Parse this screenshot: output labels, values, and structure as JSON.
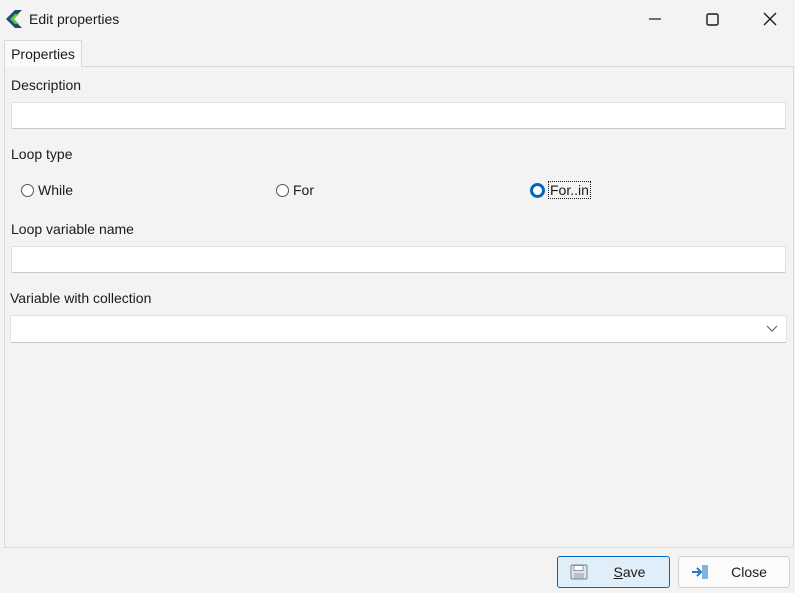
{
  "window": {
    "title": "Edit properties",
    "app_icon": "app-logo-icon",
    "controls": [
      "minimize-icon",
      "maximize-icon",
      "close-icon"
    ]
  },
  "tabs": [
    {
      "label": "Properties",
      "active": true
    }
  ],
  "form": {
    "description": {
      "label": "Description",
      "value": "",
      "placeholder": ""
    },
    "loop_type": {
      "label": "Loop type",
      "options": [
        {
          "label": "While",
          "selected": false
        },
        {
          "label": "For",
          "selected": false
        },
        {
          "label": "For..in",
          "selected": false,
          "focused": true
        }
      ]
    },
    "loop_variable_name": {
      "label": "Loop variable name",
      "value": "",
      "placeholder": ""
    },
    "variable_with_collection": {
      "label": "Variable with collection",
      "selected_value": ""
    }
  },
  "buttons": {
    "save": {
      "label": "Save",
      "icon": "floppy-disk-icon"
    },
    "close": {
      "label": "Close",
      "icon": "exit-arrow-icon"
    }
  },
  "colors": {
    "accent": "#0067c0",
    "background": "#f3f3f3",
    "save_button_bg": "#e0eef9"
  }
}
